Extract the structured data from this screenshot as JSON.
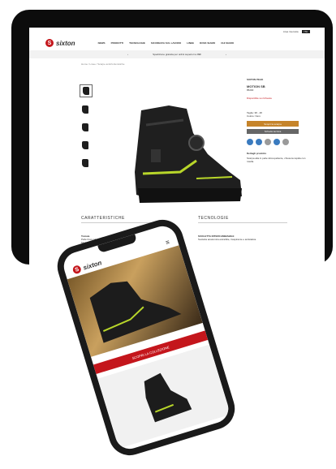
{
  "brand": {
    "name": "sixton",
    "accent": "#c4161c",
    "button_orange": "#c6842a"
  },
  "tablet": {
    "utility_bar": {
      "items": [
        "Area riservata",
        "ITA"
      ]
    },
    "nav": {
      "menu": [
        "NEWS",
        "PRODOTTI",
        "TECNOLOGIE",
        "SICUREZZA SUL LAVORO",
        "LINEE",
        "DOVE SIAMO",
        "CHI SIAMO"
      ]
    },
    "promo": {
      "left": "‹",
      "text": "Spedizione gratuita per ordini superiori a 99€",
      "right": "›"
    },
    "breadcrumb": "Home / Linee / Scarpe antinfortunistiche",
    "product": {
      "brand": "SIXTON PEAK",
      "name": "MOTION SB",
      "code": "85200",
      "price_note": "Disponibile su richiesta",
      "size_label": "Taglia: 38 - 48",
      "color_label": "Colore: Nero",
      "cta": "Scopri la scarpa",
      "secondary_cta": "Scheda tecnica",
      "desc_title": "Dettagli prodotto",
      "desc": "Scarpa alta in pelle idrorepellente, chiusura rapida con rotella."
    },
    "sections": {
      "left_title": "CARATTERISTICHE",
      "right_title": "TECNOLOGIE",
      "left_items": [
        "Tomaia",
        "Pelle Fiore Idrorepellente",
        "Modulo Active",
        "Suoletta",
        "Foderа"
      ],
      "right_heading": "SUOLETTA INTERCAMBIABILE",
      "right_text": "Suoletta anatomica estraibile, traspirante e antistatica."
    }
  },
  "phone": {
    "cta": "SCOPRI LA COLLEZIONE"
  }
}
